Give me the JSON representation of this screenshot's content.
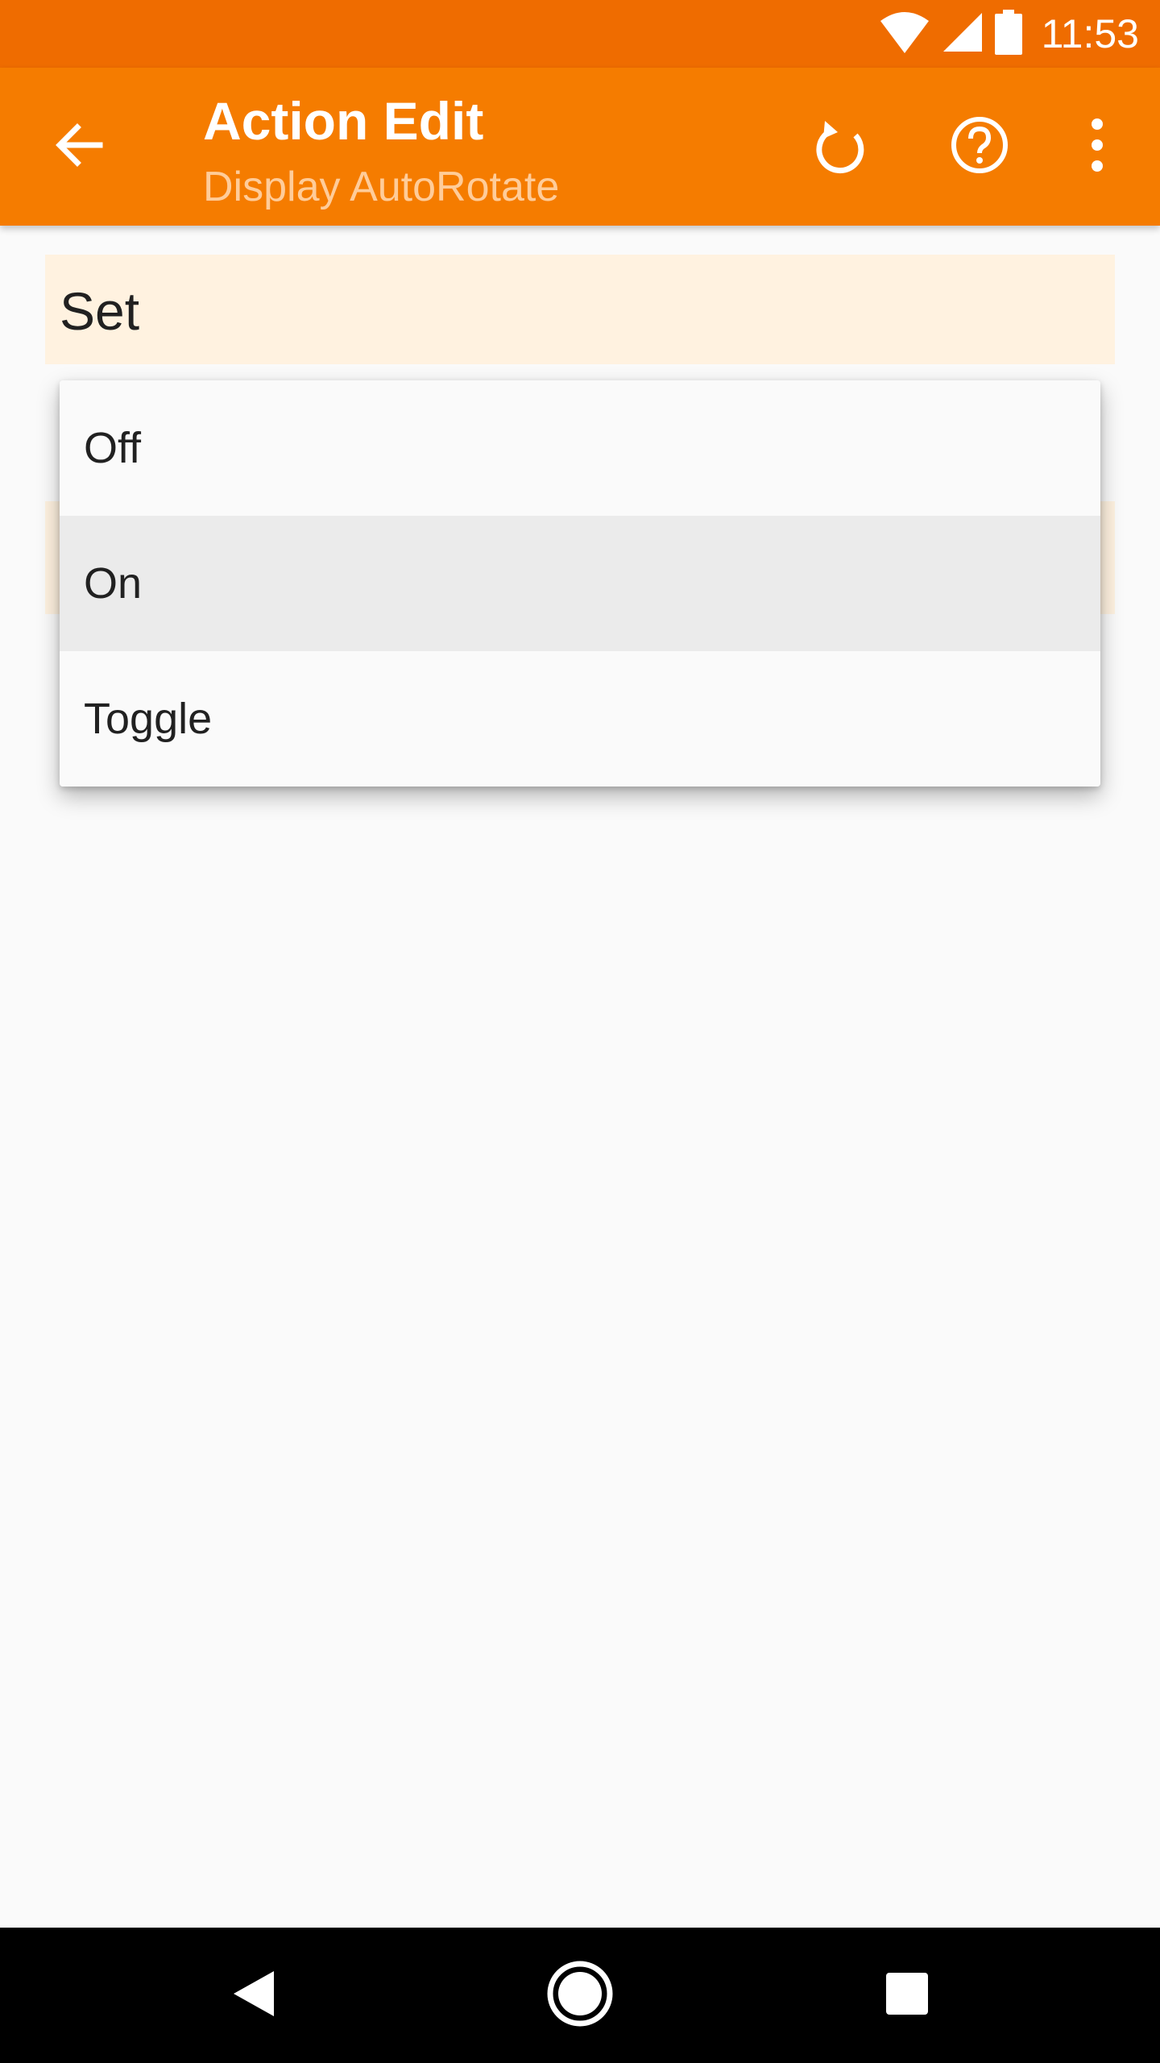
{
  "status_bar": {
    "time": "11:53",
    "icons": [
      "wifi-icon",
      "cell-signal-icon",
      "battery-icon"
    ]
  },
  "app_bar": {
    "title": "Action Edit",
    "subtitle": "Display AutoRotate",
    "back_icon": "arrow-back-icon",
    "actions": [
      "undo-icon",
      "help-icon",
      "more-vert-icon"
    ]
  },
  "content": {
    "set_label": "Set"
  },
  "dropdown": {
    "options": [
      "Off",
      "On",
      "Toggle"
    ],
    "selected": "On"
  },
  "nav_bar": {
    "icons": [
      "nav-back-icon",
      "nav-home-icon",
      "nav-recents-icon"
    ]
  },
  "colors": {
    "status_bar": "#ef6c00",
    "app_bar": "#f57c00",
    "subtitle": "#ffcc99",
    "field_background": "#fff2e0",
    "selected_option": "#ebebeb",
    "background": "#fafafa"
  }
}
